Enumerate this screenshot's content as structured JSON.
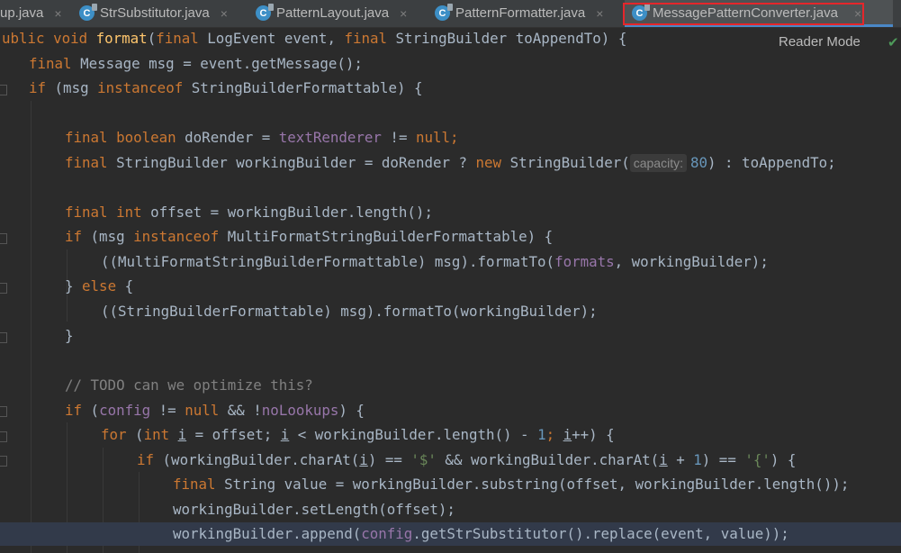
{
  "tabs": [
    {
      "label": "up.java",
      "has_icon": false
    },
    {
      "label": "StrSubstitutor.java",
      "has_icon": true
    },
    {
      "label": "PatternLayout.java",
      "has_icon": true
    },
    {
      "label": "PatternFormatter.java",
      "has_icon": true
    },
    {
      "label": "MessagePatternConverter.java",
      "has_icon": true,
      "active": true
    }
  ],
  "tab_close_glyph": "×",
  "tab_icon_letter": "C",
  "toolbar": {
    "reader_mode_label": "Reader Mode",
    "check_glyph": "✔"
  },
  "inlay_hint": {
    "capacity": "capacity:"
  },
  "colors": {
    "keyword": "#cc7832",
    "method": "#ffc66d",
    "field": "#9876aa",
    "number": "#6897bb",
    "string": "#6a8759",
    "comment": "#808080",
    "text": "#a9b7c6",
    "background": "#2b2b2b",
    "highlight_box": "#e5262b"
  },
  "code": {
    "l1": {
      "a": "ublic void ",
      "b": "format",
      "c": "(",
      "d": "final ",
      "e": "LogEvent event, ",
      "f": "final ",
      "g": "StringBuilder toAppendTo) {"
    },
    "l2": {
      "a": "final ",
      "b": "Message msg = event.getMessage();"
    },
    "l3": {
      "a": "if ",
      "b": "(msg ",
      "c": "instanceof ",
      "d": "StringBuilderFormattable) {"
    },
    "l5": {
      "a": "final boolean ",
      "b": "doRender = ",
      "c": "textRenderer",
      "d": " != ",
      "e": "null",
      "f": ";"
    },
    "l6": {
      "a": "final ",
      "b": "StringBuilder workingBuilder = doRender ? ",
      "c": "new ",
      "d": "StringBuilder(",
      "e": "80",
      "f": ") : toAppendTo;"
    },
    "l8": {
      "a": "final int ",
      "b": "offset = workingBuilder.length();"
    },
    "l9": {
      "a": "if ",
      "b": "(msg ",
      "c": "instanceof ",
      "d": "MultiFormatStringBuilderFormattable) {"
    },
    "l10": {
      "a": "((MultiFormatStringBuilderFormattable) msg).formatTo(",
      "b": "formats",
      "c": ", workingBuilder);"
    },
    "l11": {
      "a": "} ",
      "b": "else ",
      "c": "{"
    },
    "l12": {
      "a": "((StringBuilderFormattable) msg).formatTo(workingBuilder);"
    },
    "l13": {
      "a": "}"
    },
    "l15": {
      "a": "// TODO can we optimize this?"
    },
    "l16": {
      "a": "if ",
      "b": "(",
      "c": "config",
      "d": " != ",
      "e": "null ",
      "f": "&& !",
      "g": "noLookups",
      "h": ") {"
    },
    "l17": {
      "a": "for ",
      "b": "(",
      "c": "int ",
      "d": "i",
      "e": " = offset; ",
      "f": "i",
      "g": " < workingBuilder.length() - ",
      "h": "1",
      "i": "; ",
      "j": "i",
      "k": "++) {"
    },
    "l18": {
      "a": "if ",
      "b": "(workingBuilder.charAt(",
      "c": "i",
      "d": ") == ",
      "e": "'$'",
      "f": " && workingBuilder.charAt(",
      "g": "i",
      "h": " + ",
      "i": "1",
      "j": ") == ",
      "k": "'{'",
      "l": ") {"
    },
    "l19": {
      "a": "final ",
      "b": "String value = workingBuilder.substring(offset, workingBuilder.length());"
    },
    "l20": {
      "a": "workingBuilder.setLength(offset);"
    },
    "l21": {
      "a": "workingBuilder.append(",
      "b": "config",
      "c": ".getStrSubstitutor().replace(event, value));"
    }
  }
}
